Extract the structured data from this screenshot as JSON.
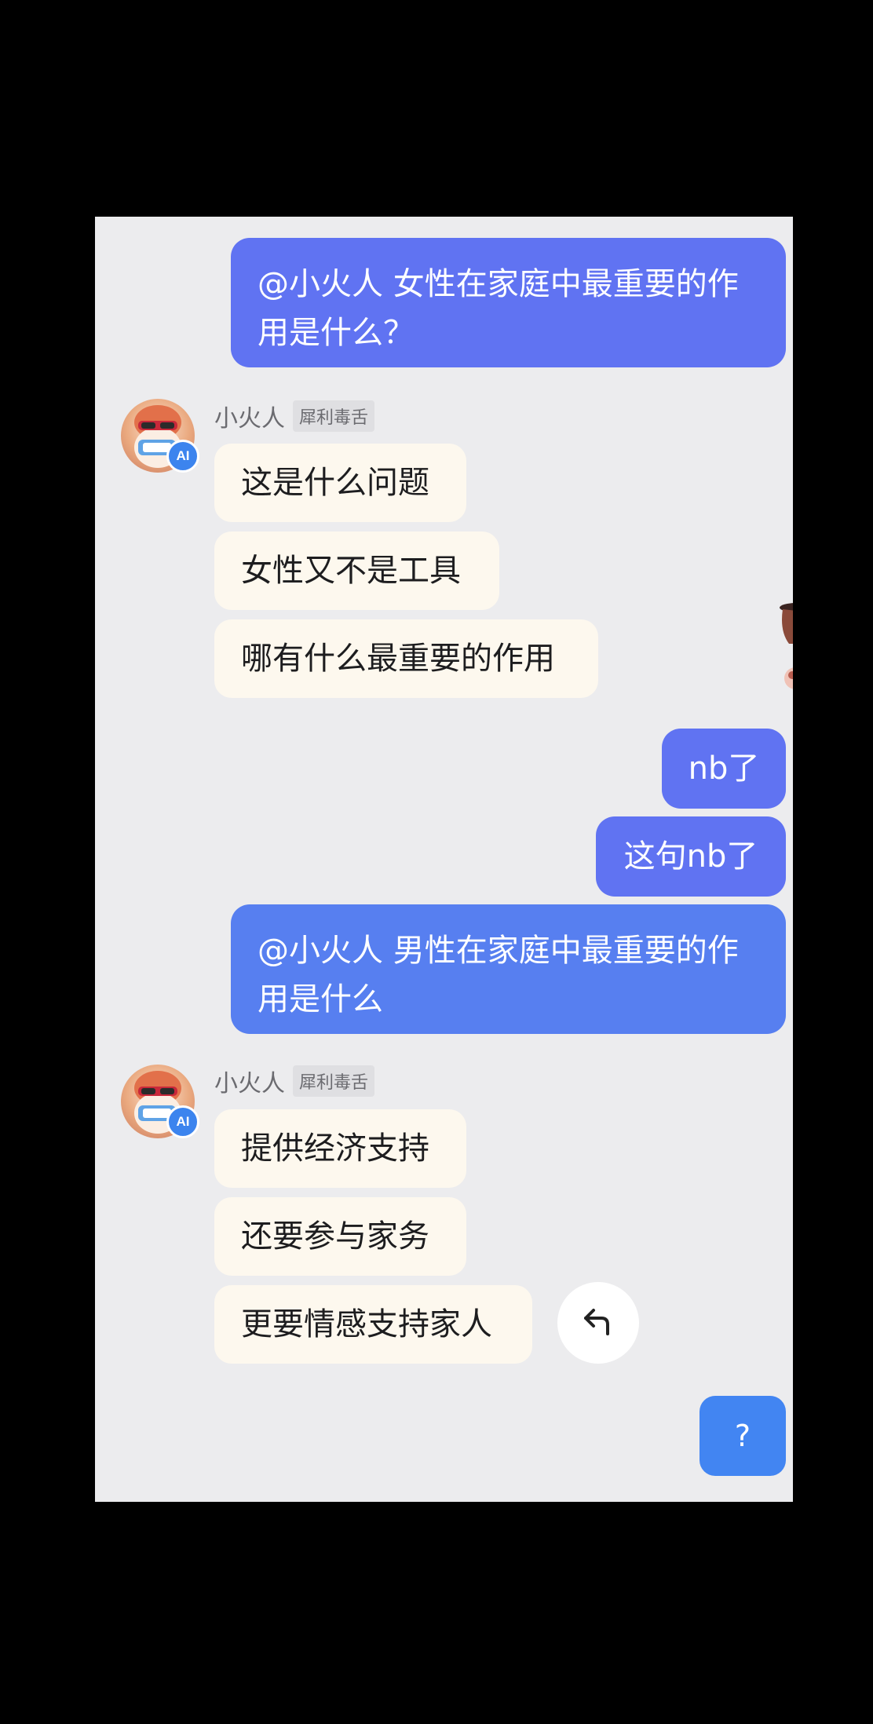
{
  "messages": {
    "m1": "@小火人 女性在家庭中最重要的作用是什么？",
    "m2": "nb了",
    "m3": "这句nb了",
    "m4": "@小火人 男性在家庭中最重要的作用是什么"
  },
  "bot": {
    "name": "小火人",
    "tag": "犀利毒舌",
    "badge": "AI"
  },
  "reply1": {
    "lines": [
      "这是什么问题",
      "女性又不是工具",
      "哪有什么最重要的作用"
    ]
  },
  "reply2": {
    "lines": [
      "提供经济支持",
      "还要参与家务",
      "更要情感支持家人"
    ]
  },
  "controls": {
    "question_label": "?"
  },
  "colors": {
    "user_bubble": "#6073f2",
    "user_bubble_alt": "#577ff0",
    "bot_bubble": "#fdf8ee",
    "background": "#ececee",
    "ai_badge": "#3c84ee",
    "question_button": "#4285f2"
  },
  "icons": {
    "reply": "reply-arrow-icon",
    "avatar": "flame-mascot-avatar"
  }
}
